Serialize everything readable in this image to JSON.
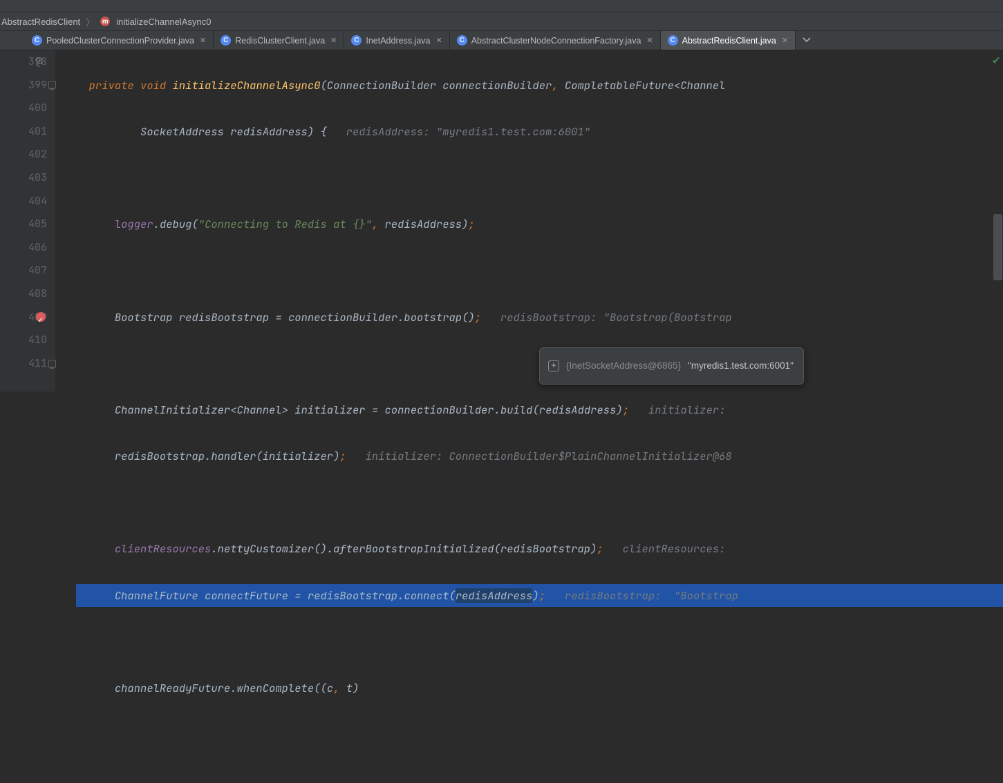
{
  "breadcrumb": {
    "class_name": "AbstractRedisClient",
    "method_name": "initializeChannelAsync0"
  },
  "tabs": [
    {
      "label": "PooledClusterConnectionProvider.java",
      "active": false
    },
    {
      "label": "RedisClusterClient.java",
      "active": false
    },
    {
      "label": "InetAddress.java",
      "active": false
    },
    {
      "label": "AbstractClusterNodeConnectionFactory.java",
      "active": false
    },
    {
      "label": "AbstractRedisClient.java",
      "active": true
    }
  ],
  "tooltip": {
    "ref": "{InetSocketAddress@6865}",
    "value": "\"myredis1.test.com:6001\""
  },
  "lines": [
    {
      "n": "398",
      "at": true
    },
    {
      "n": "399",
      "collapse": true
    },
    {
      "n": "400"
    },
    {
      "n": "401"
    },
    {
      "n": "402"
    },
    {
      "n": "403"
    },
    {
      "n": "404"
    },
    {
      "n": "405"
    },
    {
      "n": "406"
    },
    {
      "n": "407"
    },
    {
      "n": "408"
    },
    {
      "n": "409",
      "bp": true
    },
    {
      "n": "410"
    },
    {
      "n": "411",
      "collapse": true
    }
  ],
  "tokens": {
    "kw_private": "private",
    "kw_void": "void",
    "fn_name": "initializeChannelAsync0",
    "t_connbuilder": "ConnectionBuilder",
    "p_connbuilder": "connectionBuilder",
    "t_compfut": "CompletableFuture",
    "t_channel": "Channel",
    "t_sockaddr": "SocketAddress",
    "p_redisaddr": "redisAddress",
    "hint_398": "redisAddress: \"myredis1.test.com:6001\"",
    "logger": "logger",
    "m_debug": "debug",
    "str_connecting": "\"Connecting to Redis at {}\"",
    "t_bootstrap": "Bootstrap",
    "v_redisbootstrap": "redisBootstrap",
    "m_bootstrap": "bootstrap",
    "hint_403": "redisBootstrap: \"Bootstrap(Bootstrap",
    "t_chinit": "ChannelInitializer",
    "v_initializer": "initializer",
    "m_build": "build",
    "hint_405": "initializer: ",
    "m_handler": "handler",
    "hint_406": "initializer: ConnectionBuilder$PlainChannelInitializer@68",
    "fld_clientres": "clientResources",
    "m_nettycust": "nettyCustomizer",
    "m_afterboot": "afterBootstrapInitialized",
    "hint_408": "clientResources: ",
    "t_chfut": "ChannelFuture",
    "v_connectfut": "connectFuture",
    "m_connect": "connect",
    "hint_409": "redisBootstrap:  \"Bootstrap",
    "v_channelready": "channelReadyFuture",
    "m_whencomplete": "whenComplete",
    "p_c": "c",
    "p_t": "t"
  }
}
